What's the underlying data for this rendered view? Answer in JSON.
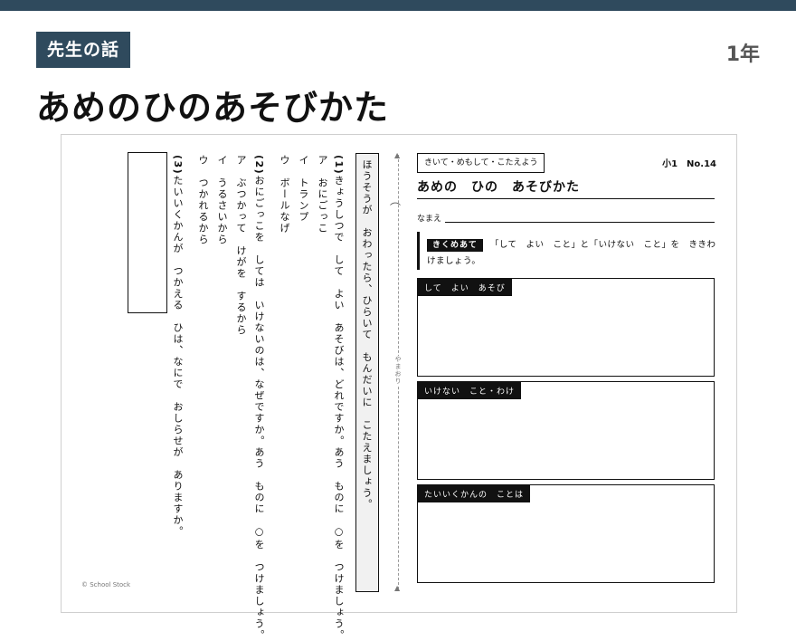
{
  "header": {
    "badge": "先生の話",
    "grade": "1年",
    "title": "あめのひのあそびかた"
  },
  "worksheet": {
    "tag": "きいて・めもして・こたえよう",
    "number": "小1　No.14",
    "title": "あめの　ひの　あそびかた",
    "name_label": "なまえ",
    "kiku_tag": "きくめあて",
    "kiku_text": "「して　よい　こと」と「いけない　こと」を　ききわけましょう。",
    "boxes": [
      {
        "label": "して　よい　あそび"
      },
      {
        "label": "いけない　こと・わけ"
      },
      {
        "label": "たいいくかんの　ことは"
      }
    ],
    "fold_label": "やまおり",
    "fold_symbol": "⌒",
    "instruction": "ほうそうが　おわったら、ひらいて　もんだいに　こたえましょう。",
    "q1": {
      "num": "(1)",
      "text": "きょうしつで　して　よい　あそびは、どれですか。あう　ものに　○を　つけましょう。",
      "options": [
        "ア　おにごっこ",
        "イ　トランプ",
        "ウ　ボールなげ"
      ]
    },
    "q2": {
      "num": "(2)",
      "text": "おにごっこを　しては　いけないのは、なぜですか。あう　ものに　○を　つけましょう。",
      "options": [
        "ア　ぶつかって　けがを　するから",
        "イ　うるさいから",
        "ウ　つかれるから"
      ]
    },
    "q3": {
      "num": "(3)",
      "text": "たいいくかんが　つかえる　ひは、なにで　おしらせが　ありますか。"
    },
    "copyright": "© School Stock"
  }
}
